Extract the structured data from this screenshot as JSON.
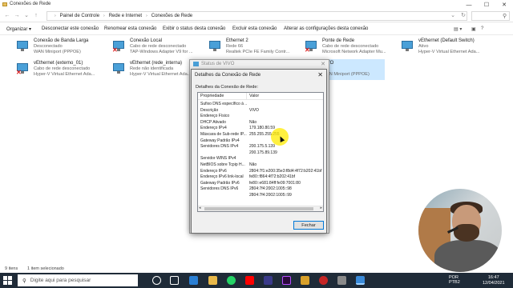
{
  "window": {
    "title": "Conexões de Rede",
    "minimize": "—",
    "maximize": "☐",
    "close": "✕"
  },
  "address": {
    "crumbs": [
      "Painel de Controle",
      "Rede e Internet",
      "Conexões de Rede"
    ]
  },
  "toolbar": {
    "organize": "Organizar ▾",
    "disable": "Desconectar este conexão",
    "rename": "Renomear esta conexão",
    "view_status": "Exibir o status desta conexão",
    "delete": "Excluir esta conexão",
    "change_settings": "Alterar as configurações desta conexão"
  },
  "connections": [
    {
      "name": "Conexão de Banda Larga",
      "line1": "Desconectado",
      "line2": "WAN Miniport (PPPOE)"
    },
    {
      "name": "Conexão Local",
      "line1": "Cabo de rede desconectado",
      "line2": "TAP-Windows Adapter V9 for ..."
    },
    {
      "name": "Ethernet 2",
      "line1": "Rede 66",
      "line2": "Realtek PCIe FE Family Contr..."
    },
    {
      "name": "Ponte de Rede",
      "line1": "Cabo de rede desconectado",
      "line2": "Microsoft Network Adapter Mu..."
    },
    {
      "name": "vEthernet (Default Switch)",
      "line1": "Ativo",
      "line2": "Hyper-V Virtual Ethernet Ada..."
    },
    {
      "name": "vEthernet (externo_01)",
      "line1": "Cabo de rede desconectado",
      "line2": "Hyper-V Virtual Ethernet Ada..."
    },
    {
      "name": "vEthernet (rede_interna)",
      "line1": "Rede não identificada",
      "line2": "Hyper-V Virtual Ethernet Ada..."
    },
    {
      "name": "VIVO",
      "line1": "",
      "line2": "WAN Miniport (PPPOE)"
    }
  ],
  "status_dialog": {
    "title": "Status de VIVO"
  },
  "details_dialog": {
    "title": "Detalhes da Conexão de Rede",
    "group_label": "Detalhes da Conexão de Rede:",
    "col_property": "Propriedade",
    "col_value": "Valor",
    "rows": [
      {
        "k": "Sufixo DNS específico à ...",
        "v": ""
      },
      {
        "k": "Descrição",
        "v": "VIVO"
      },
      {
        "k": "Endereço Físico",
        "v": ""
      },
      {
        "k": "DHCP Ativado",
        "v": "Não"
      },
      {
        "k": "Endereço IPv4",
        "v": "179.180.80.59"
      },
      {
        "k": "Máscara de Sub-rede IP...",
        "v": "255.255.255.255"
      },
      {
        "k": "Gateway Padrão IPv4",
        "v": ""
      },
      {
        "k": "Servidores DNS IPv4",
        "v": "200.175.5.139"
      },
      {
        "k": "",
        "v": "200.175.89.139"
      },
      {
        "k": "Servidor WINS IPv4",
        "v": ""
      },
      {
        "k": "NetBIOS sobre Tcpip H...",
        "v": "Não"
      },
      {
        "k": "Endereço IPv6",
        "v": "2804:7f1:e200:35e3:f8d4:4f72:b202:41bf"
      },
      {
        "k": "Endereço IPv6 link-local",
        "v": "fe80::f864:4f72:b202:41bf"
      },
      {
        "k": "Gateway Padrão IPv6",
        "v": "fe80::e681:84ff:fe09:7001:80"
      },
      {
        "k": "Servidores DNS IPv6",
        "v": "2804:7f4:2002:1005::98"
      },
      {
        "k": "",
        "v": "2804:7f4:2002:1005::99"
      }
    ],
    "close_button": "Fechar"
  },
  "statusbar": {
    "items": "9 itens",
    "selected": "1 item selecionado"
  },
  "taskbar": {
    "search_placeholder": "Digite aqui para pesquisar",
    "lang": "POR",
    "layout": "PTB2",
    "time": "16:47",
    "date": "12/04/2021"
  },
  "colors": {
    "taskbar_bg": "#1f2b38",
    "accent": "#0078d7",
    "selection": "#cce8ff"
  }
}
